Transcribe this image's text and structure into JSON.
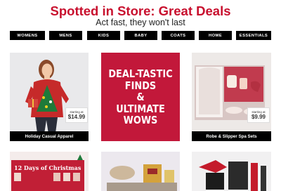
{
  "header": {
    "title": "Spotted in Store: Great Deals",
    "subtitle": "Act fast, they won't last"
  },
  "nav": [
    {
      "label": "WOMENS"
    },
    {
      "label": "MENS"
    },
    {
      "label": "KIDS"
    },
    {
      "label": "BABY"
    },
    {
      "label": "COATS"
    },
    {
      "label": "HOME"
    },
    {
      "label": "ESSENTIALS"
    }
  ],
  "tiles": {
    "holiday": {
      "caption": "Holiday Casual Apparel",
      "price_label": "starting at",
      "price": "$14.99"
    },
    "promo": {
      "line1": "DEAL-TASTIC",
      "line2": "FINDS",
      "line3": "&",
      "line4": "ULTIMATE",
      "line5": "WOWS"
    },
    "spa": {
      "caption": "Robe & Slipper Spa Sets",
      "price_label": "starting at",
      "price": "$9.99"
    }
  },
  "bottom_tiles": {
    "calendar_text": "12 Days of Christmas"
  },
  "colors": {
    "brand_red": "#c8102e",
    "promo_red": "#c2183a",
    "nav_black": "#000000"
  }
}
